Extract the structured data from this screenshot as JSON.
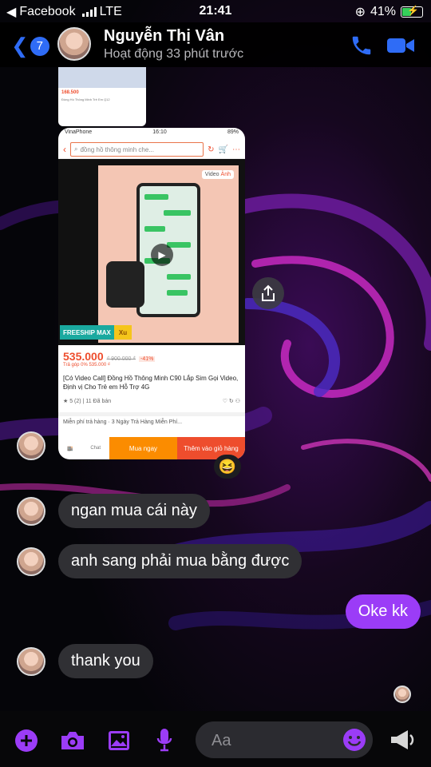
{
  "status": {
    "app": "Facebook",
    "network": "LTE",
    "time": "21:41",
    "battery": "41%"
  },
  "header": {
    "back_count": "7",
    "name": "Nguyễn Thị Vân",
    "activity": "Hoạt động 33 phút trước"
  },
  "shared_product": {
    "mini_status_carrier": "VinaPhone",
    "mini_status_time": "16:10",
    "mini_status_battery": "89%",
    "search_placeholder": "đồng hồ thông minh che...",
    "video_tab": "Video",
    "image_tab": "Ảnh",
    "freeship_label": "FREESHIP MAX",
    "xu_label": "Xu",
    "price": "535.000",
    "old_price": "₫ 900.000 ₫",
    "discount": "-41%",
    "installment": "Trả góp 0% 535.000 ₫",
    "title": "[Có Video Call] Đồng Hồ Thông Minh C90 Lắp Sim Gọi Video, Định vị Cho Trẻ em Hỗ Trợ 4G",
    "rating": "★ 5 (2)",
    "sold": "11 Đã bán",
    "shipping": "Miễn phí trả hàng · 3 Ngày Trả Hàng Miễn Phí...",
    "chat_label": "Chat",
    "buy_now": "Mua ngay",
    "add_to_cart": "Thêm vào giỏ hàng",
    "reaction_emoji": "😆"
  },
  "messages": [
    {
      "sender": "them",
      "text": "ngan mua cái này"
    },
    {
      "sender": "them",
      "text": "anh sang phải mua bằng được"
    },
    {
      "sender": "me",
      "text": "Oke kk"
    },
    {
      "sender": "them",
      "text": "thank you"
    }
  ],
  "composer": {
    "placeholder": "Aa",
    "emoji": "😊"
  },
  "colors": {
    "accent": "#9b3cf7",
    "link_blue": "#2f6cf6",
    "incoming_bubble": "#303034"
  },
  "icons": [
    "back-chevron-icon",
    "phone-icon",
    "video-camera-icon",
    "share-icon",
    "plus-icon",
    "camera-icon",
    "gallery-icon",
    "microphone-icon",
    "emoji-icon",
    "megaphone-icon"
  ]
}
